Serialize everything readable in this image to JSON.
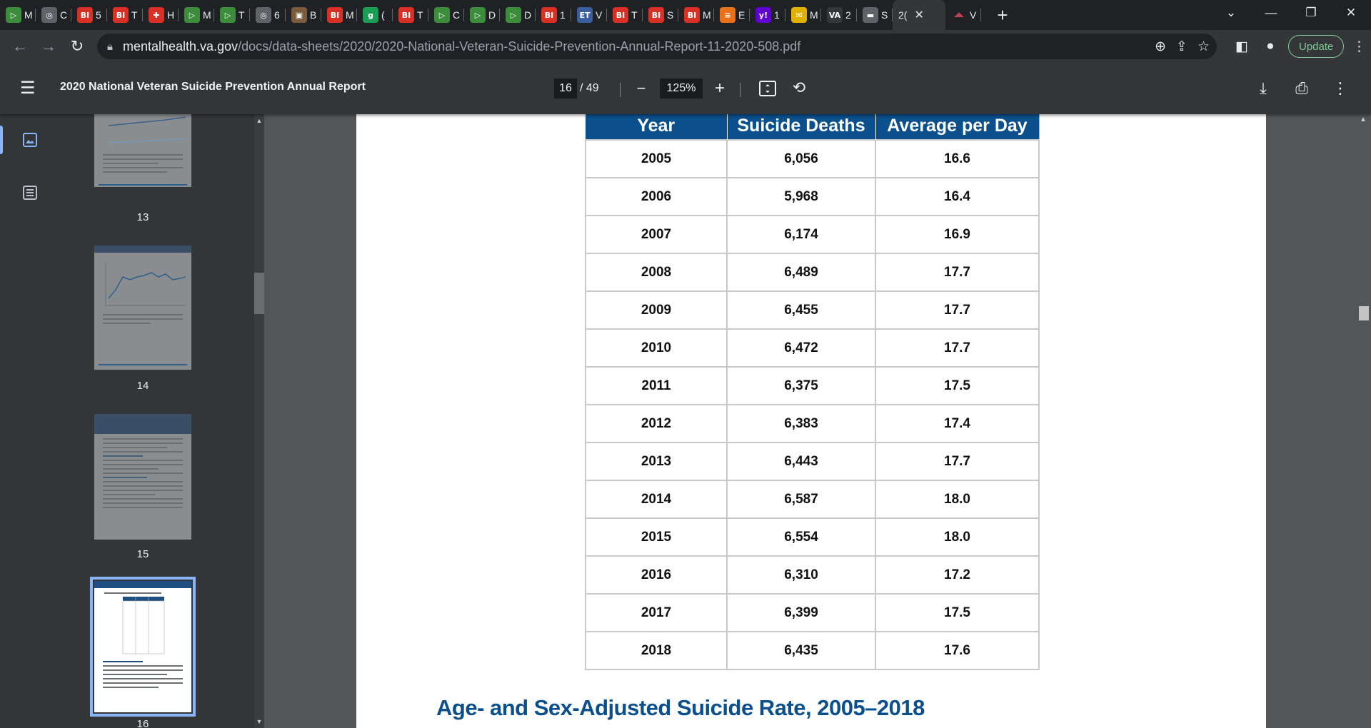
{
  "tabs": [
    {
      "icon": "▷",
      "color": "#3c8c3c",
      "title": "M"
    },
    {
      "icon": "◎",
      "color": "#5f6368",
      "title": "C"
    },
    {
      "icon": "BI",
      "color": "#d93025",
      "title": "5"
    },
    {
      "icon": "BI",
      "color": "#d93025",
      "title": "T"
    },
    {
      "icon": "✚",
      "color": "#d93025",
      "title": "H"
    },
    {
      "icon": "▷",
      "color": "#3c8c3c",
      "title": "M"
    },
    {
      "icon": "▷",
      "color": "#3c8c3c",
      "title": "T"
    },
    {
      "icon": "◎",
      "color": "#5f6368",
      "title": "6"
    },
    {
      "icon": "▣",
      "color": "#7a5c3c",
      "title": "B"
    },
    {
      "icon": "BI",
      "color": "#d93025",
      "title": "M"
    },
    {
      "icon": "g",
      "color": "#1a9e55",
      "title": "("
    },
    {
      "icon": "BI",
      "color": "#d93025",
      "title": "T"
    },
    {
      "icon": "▷",
      "color": "#3c8c3c",
      "title": "C"
    },
    {
      "icon": "▷",
      "color": "#3c8c3c",
      "title": "D"
    },
    {
      "icon": "▷",
      "color": "#3c8c3c",
      "title": "D"
    },
    {
      "icon": "BI",
      "color": "#d93025",
      "title": "1"
    },
    {
      "icon": "ET",
      "color": "#3b5f9e",
      "title": "V"
    },
    {
      "icon": "BI",
      "color": "#d93025",
      "title": "T"
    },
    {
      "icon": "BI",
      "color": "#d93025",
      "title": "S"
    },
    {
      "icon": "BI",
      "color": "#d93025",
      "title": "M"
    },
    {
      "icon": "≡",
      "color": "#e8711a",
      "title": "E"
    },
    {
      "icon": "y!",
      "color": "#6001d2",
      "title": "1"
    },
    {
      "icon": "✉",
      "color": "#e0b100",
      "title": "M"
    },
    {
      "icon": "VA",
      "color": "#35363a",
      "title": "2"
    },
    {
      "icon": "▬",
      "color": "#5f6368",
      "title": "S"
    }
  ],
  "active_tab": {
    "title": "2("
  },
  "extra_tab": {
    "icon": "◢◣",
    "color": "#c0425b",
    "title": "V"
  },
  "address": {
    "domain": "mentalhealth.va.gov",
    "path": "/docs/data-sheets/2020/2020-National-Veteran-Suicide-Prevention-Annual-Report-11-2020-508.pdf"
  },
  "update_label": "Update",
  "pdf": {
    "title": "2020 National Veteran Suicide Prevention Annual Report",
    "current_page": "16",
    "total_pages": "/ 49",
    "zoom": "125%"
  },
  "thumbnails": [
    {
      "label": "13"
    },
    {
      "label": "14"
    },
    {
      "label": "15"
    },
    {
      "label": "16"
    }
  ],
  "table": {
    "headers": [
      "Year",
      "Suicide Deaths",
      "Average per Day"
    ],
    "rows": [
      [
        "2005",
        "6,056",
        "16.6"
      ],
      [
        "2006",
        "5,968",
        "16.4"
      ],
      [
        "2007",
        "6,174",
        "16.9"
      ],
      [
        "2008",
        "6,489",
        "17.7"
      ],
      [
        "2009",
        "6,455",
        "17.7"
      ],
      [
        "2010",
        "6,472",
        "17.7"
      ],
      [
        "2011",
        "6,375",
        "17.5"
      ],
      [
        "2012",
        "6,383",
        "17.4"
      ],
      [
        "2013",
        "6,443",
        "17.7"
      ],
      [
        "2014",
        "6,587",
        "18.0"
      ],
      [
        "2015",
        "6,554",
        "18.0"
      ],
      [
        "2016",
        "6,310",
        "17.2"
      ],
      [
        "2017",
        "6,399",
        "17.5"
      ],
      [
        "2018",
        "6,435",
        "17.6"
      ]
    ]
  },
  "section_heading": "Age- and Sex-Adjusted Suicide Rate, 2005–2018"
}
